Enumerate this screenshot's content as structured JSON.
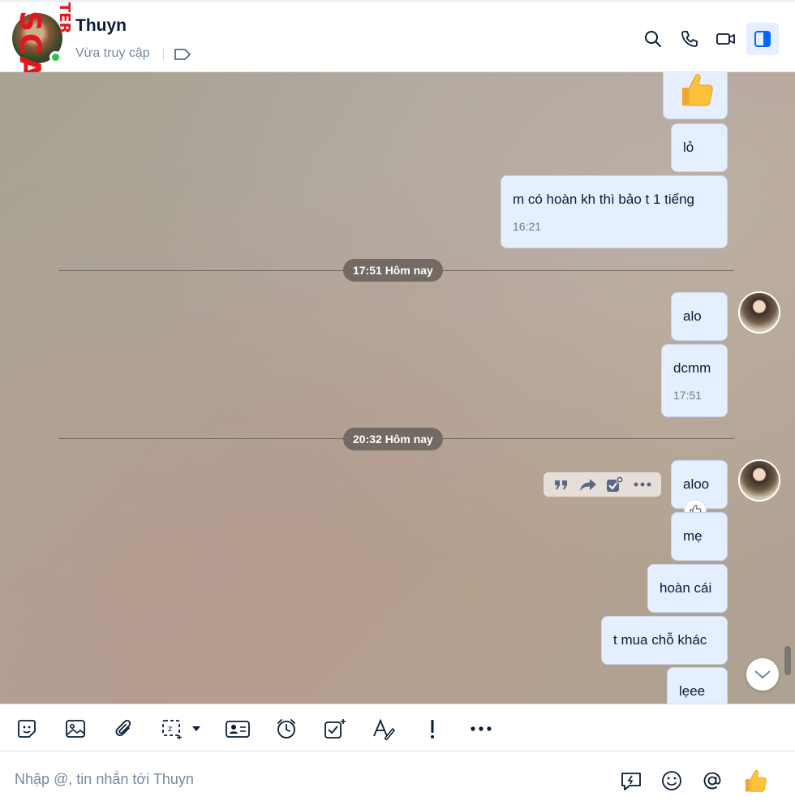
{
  "header": {
    "contact_name": "Thuyn",
    "status": "Vừa truy cập",
    "watermark_main": "SCAM.INFO",
    "watermark_small": "TER"
  },
  "messages": {
    "m1": {
      "text": "lỏ"
    },
    "m2": {
      "text": "m có hoàn kh thì bảo t 1 tiếng",
      "time": "16:21"
    },
    "divider1": "17:51 Hôm nay",
    "m3": {
      "text": "alo"
    },
    "m4": {
      "text": "dcmm",
      "time": "17:51"
    },
    "divider2": "20:32 Hôm nay",
    "m5": {
      "text": "aloo"
    },
    "m6": {
      "text": "mẹ"
    },
    "m7": {
      "text": "hoàn cái"
    },
    "m8": {
      "text": "t mua chỗ khác"
    },
    "m9": {
      "text": "lẹee"
    }
  },
  "composer": {
    "placeholder": "Nhập @, tin nhắn tới Thuyn"
  },
  "colors": {
    "accent": "#0068ff",
    "bubble": "#e5efff",
    "online": "#2fbf4f",
    "watermark": "#e3161c"
  }
}
